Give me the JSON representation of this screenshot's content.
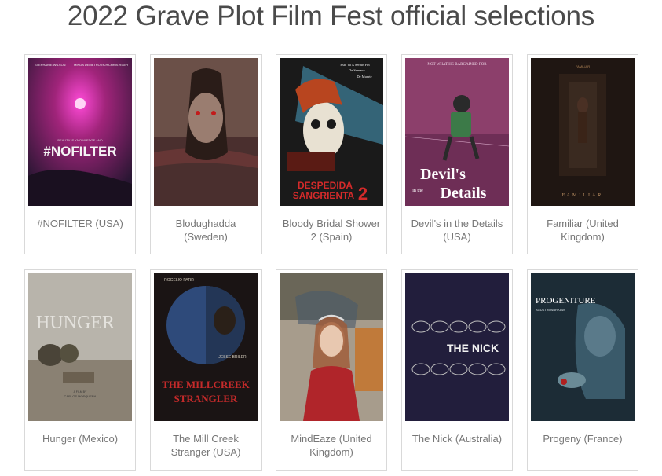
{
  "page": {
    "title": "2022 Grave Plot Film Fest official selections"
  },
  "films": [
    {
      "caption": "#NOFILTER (USA)",
      "poster_top": [
        "STEPHANIE WILSON",
        "MINDA DEMETROVICH",
        "CHRIS RIXEY"
      ],
      "poster_tagline": "BEAUTY IS KNOWLEDGE AND",
      "poster_title": "#NOFILTER"
    },
    {
      "caption": "Blodughadda (Sweden)"
    },
    {
      "caption": "Bloody Bridal Shower 2 (Spain)",
      "poster_tagline": [
        "Este Va A Ser un Fin",
        "De Semana...",
        "De Muerte"
      ],
      "poster_title": [
        "DESPEDIDA",
        "SANGRIENTA"
      ],
      "poster_number": "2"
    },
    {
      "caption": "Devil's in the Details (USA)",
      "poster_tagline": "NOT WHAT HE BARGAINED FOR",
      "poster_title": [
        "Devil's",
        "in the",
        "Details"
      ]
    },
    {
      "caption": "Familiar (United Kingdom)",
      "poster_top": "FAMILIAR",
      "poster_title": "FAMILIAR"
    },
    {
      "caption": "Hunger (Mexico)",
      "poster_title": "HUNGER",
      "poster_credit": [
        "A FILM BY",
        "CARLOS MOSQUERA"
      ]
    },
    {
      "caption": "The Mill Creek Stranger (USA)",
      "poster_top": [
        "ROGELIO PARR",
        "JESSE BRILER"
      ],
      "poster_title": [
        "THE MILLCREEK",
        "STRANGLER"
      ]
    },
    {
      "caption": "MindEaze (United Kingdom)"
    },
    {
      "caption": "The Nick (Australia)",
      "poster_title": "THE NICK"
    },
    {
      "caption": "Progeny (France)",
      "poster_title": "PROGENITURE",
      "poster_credit": "AGUSTIN WARKAW"
    }
  ],
  "colors": {
    "title": "#4a4a4a",
    "caption": "#777777",
    "card_border": "#d9d9d9"
  }
}
